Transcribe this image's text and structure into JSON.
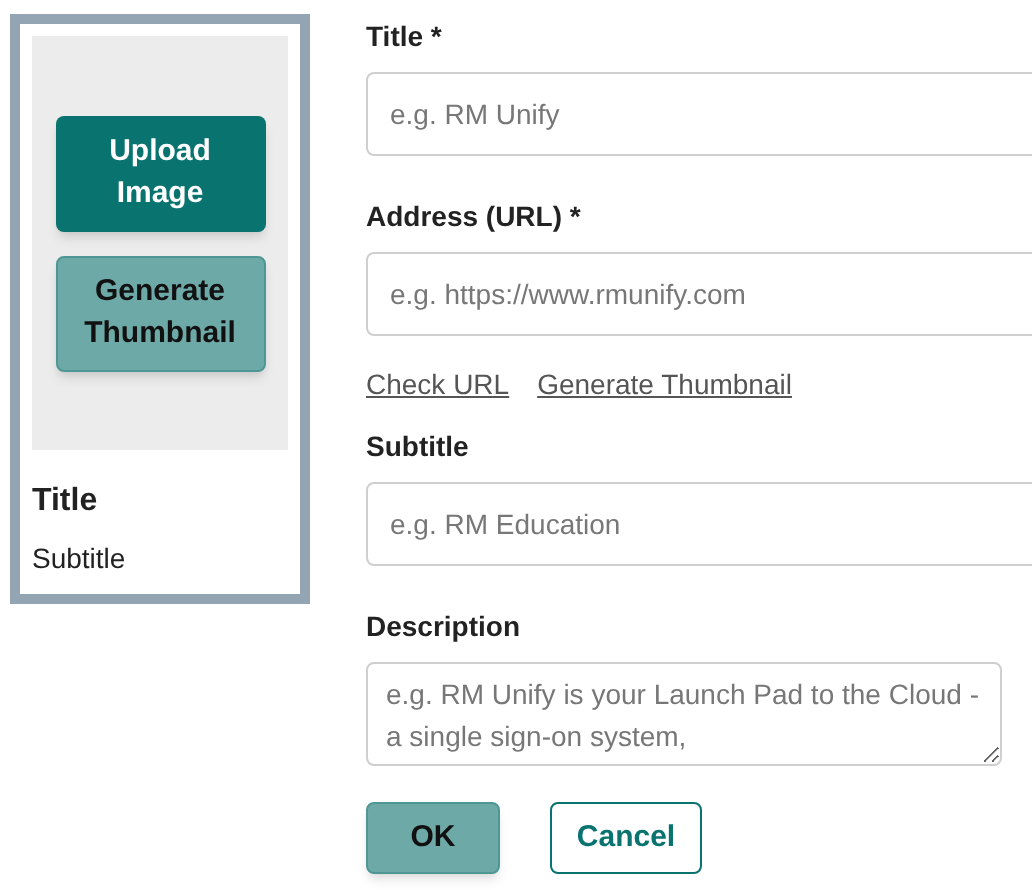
{
  "preview": {
    "upload_button": "Upload Image",
    "generate_button": "Generate Thumbnail",
    "title": "Title",
    "subtitle": "Subtitle"
  },
  "fields": [
    {
      "kind": "input",
      "label": "Title *",
      "placeholder": "e.g. RM Unify"
    },
    {
      "kind": "input",
      "label": "Address (URL) *",
      "placeholder": "e.g. https://www.rmunify.com",
      "links": [
        "Check URL",
        "Generate Thumbnail"
      ]
    },
    {
      "kind": "input",
      "label": "Subtitle",
      "placeholder": "e.g. RM Education"
    },
    {
      "kind": "textarea",
      "label": "Description",
      "placeholder": "e.g. RM Unify is your Launch Pad to the Cloud - a single sign-on system,"
    }
  ],
  "buttons": [
    {
      "label": "OK",
      "kind": "primary"
    },
    {
      "label": "Cancel",
      "kind": "secondary"
    }
  ]
}
